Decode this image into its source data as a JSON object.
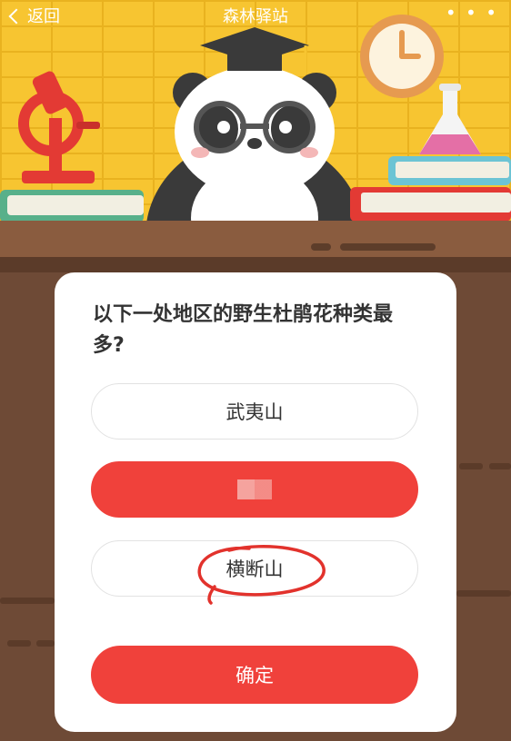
{
  "topbar": {
    "back_label": "返回",
    "title": "森林驿站",
    "more_label": "• • •"
  },
  "quiz": {
    "question": "以下一处地区的野生杜鹃花种类最多?",
    "options": [
      {
        "label": "武夷山",
        "state": "normal"
      },
      {
        "label": "",
        "state": "selected"
      },
      {
        "label": "横断山",
        "state": "normal"
      }
    ],
    "confirm_label": "确定"
  },
  "colors": {
    "accent": "#f0413b",
    "wall": "#f7c531",
    "wood": "#6e4a36"
  }
}
